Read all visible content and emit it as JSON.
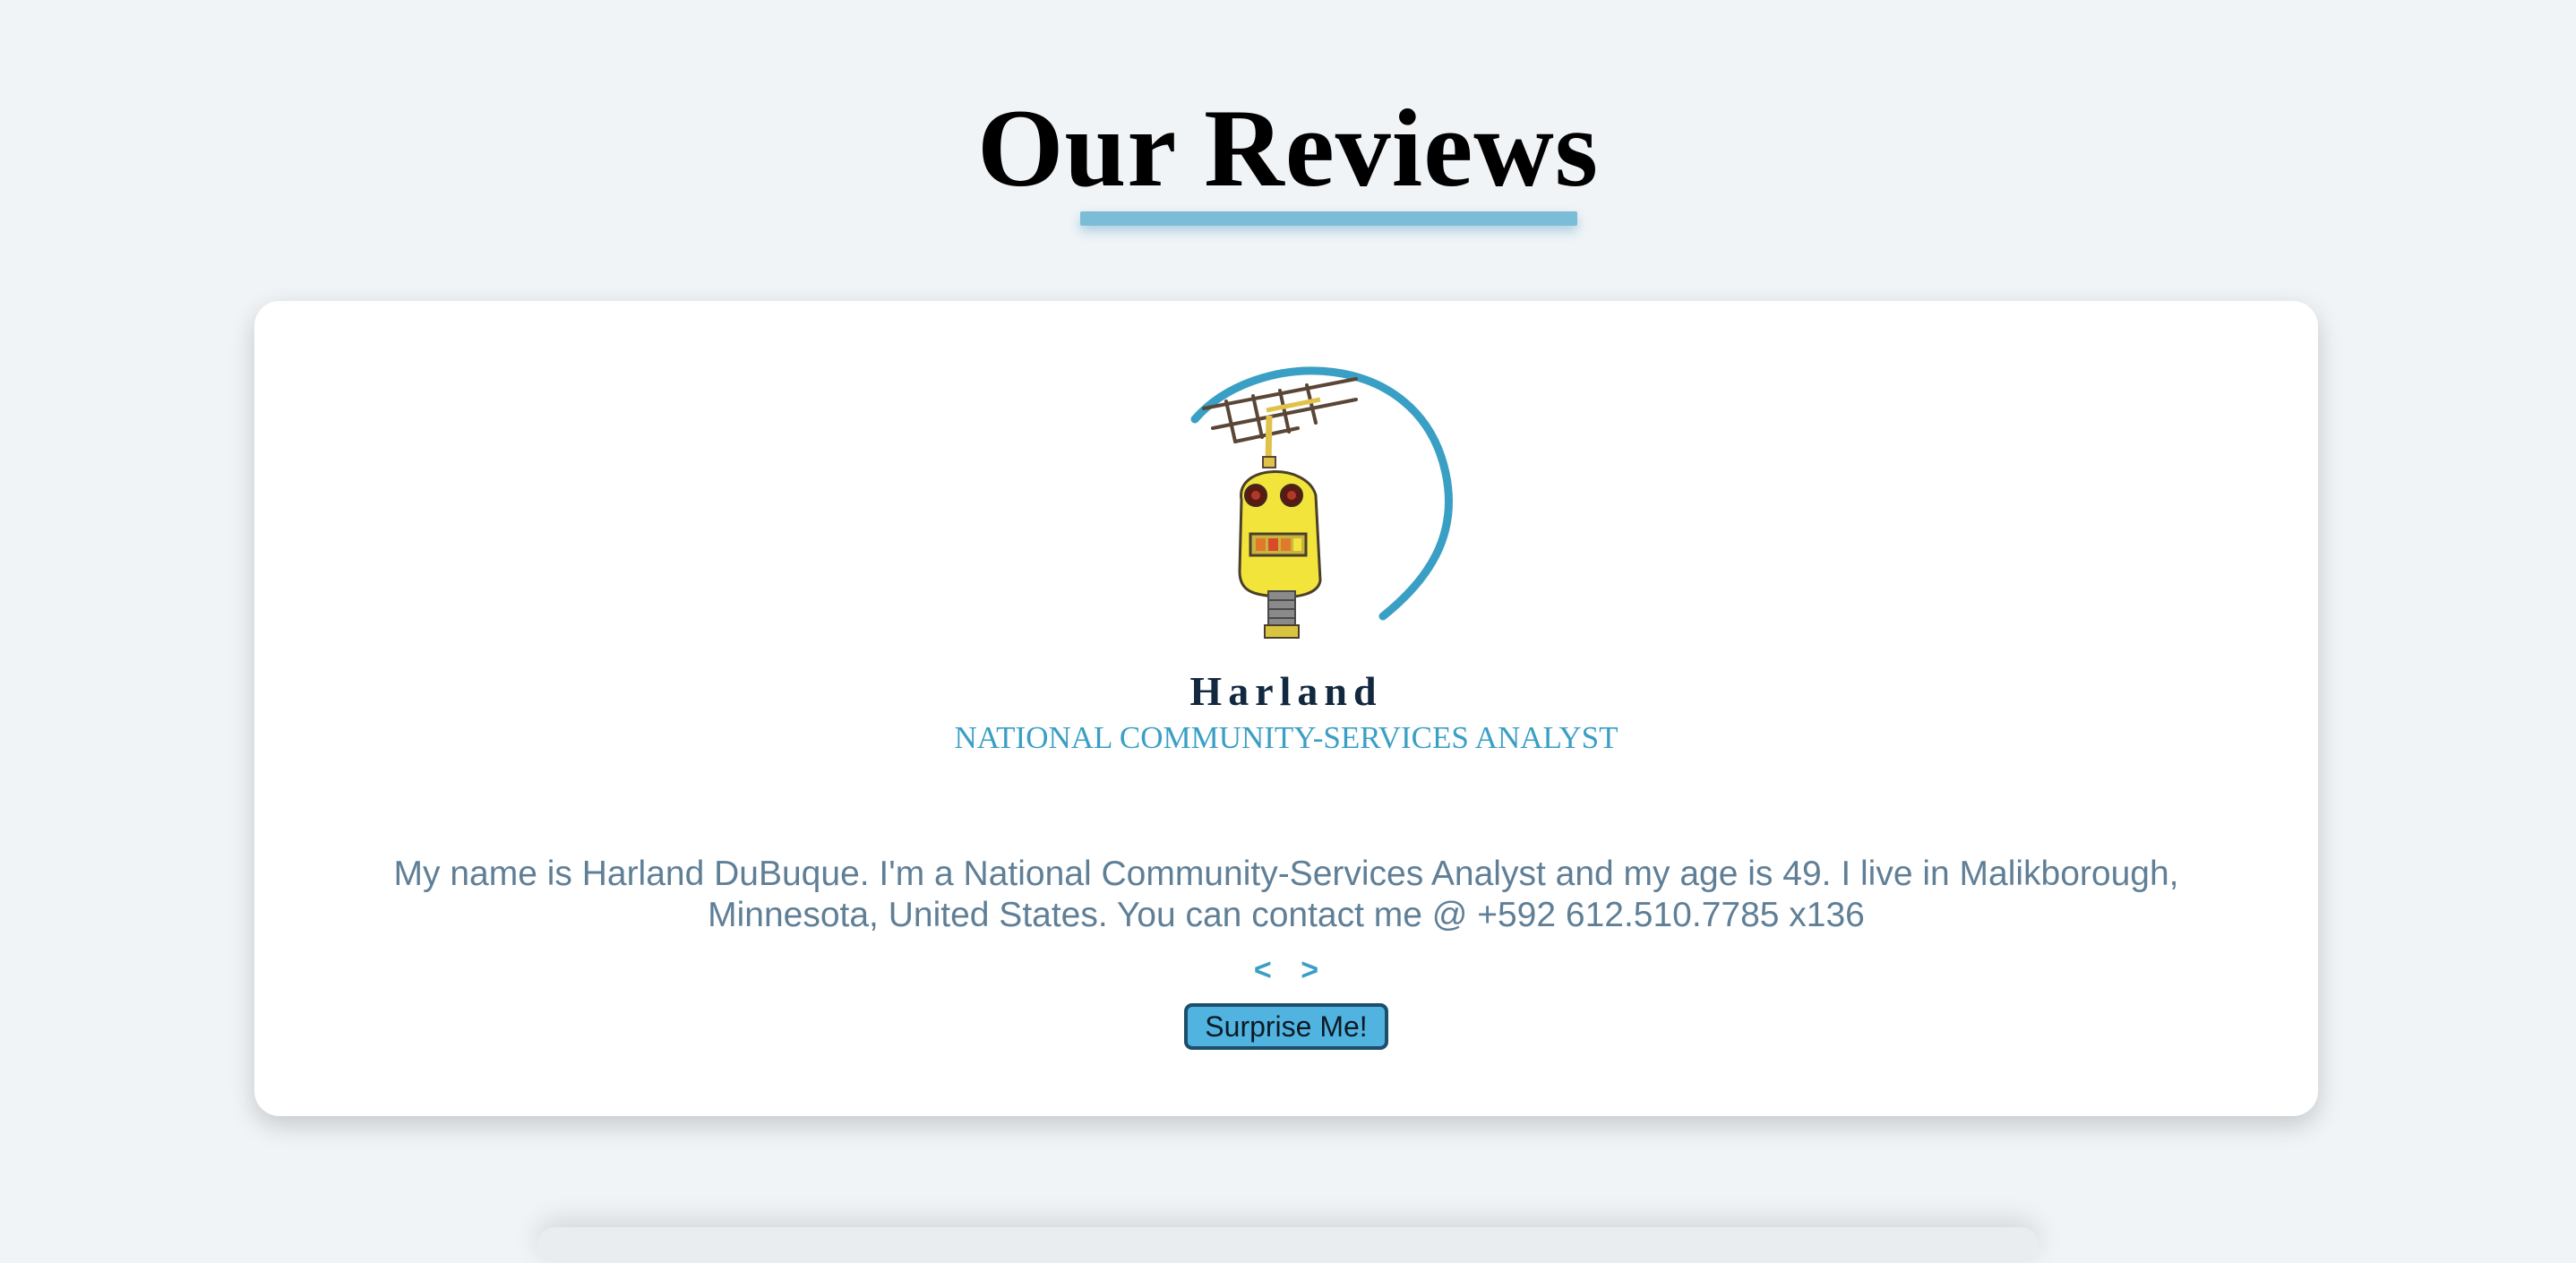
{
  "page": {
    "title": "Our Reviews"
  },
  "review": {
    "avatar_icon": "robot-with-antenna-avatar",
    "name": "Harland",
    "job": "NATIONAL COMMUNITY-SERVICES ANALYST",
    "text": "My name is Harland DuBuque. I'm a National Community-Services Analyst and my age is 49. I live in Malikborough, Minnesota, United States. You can contact me @ +592 612.510.7785 x136"
  },
  "controls": {
    "prev_label": "<",
    "next_label": ">",
    "surprise_label": "Surprise Me!"
  },
  "colors": {
    "background": "#f0f4f7",
    "accent": "#3a9fc4",
    "underline": "#7bbcd6",
    "name": "#12283f",
    "text": "#5f7f97",
    "button_fill": "#51b4e0",
    "button_border": "#1d4e6b"
  }
}
